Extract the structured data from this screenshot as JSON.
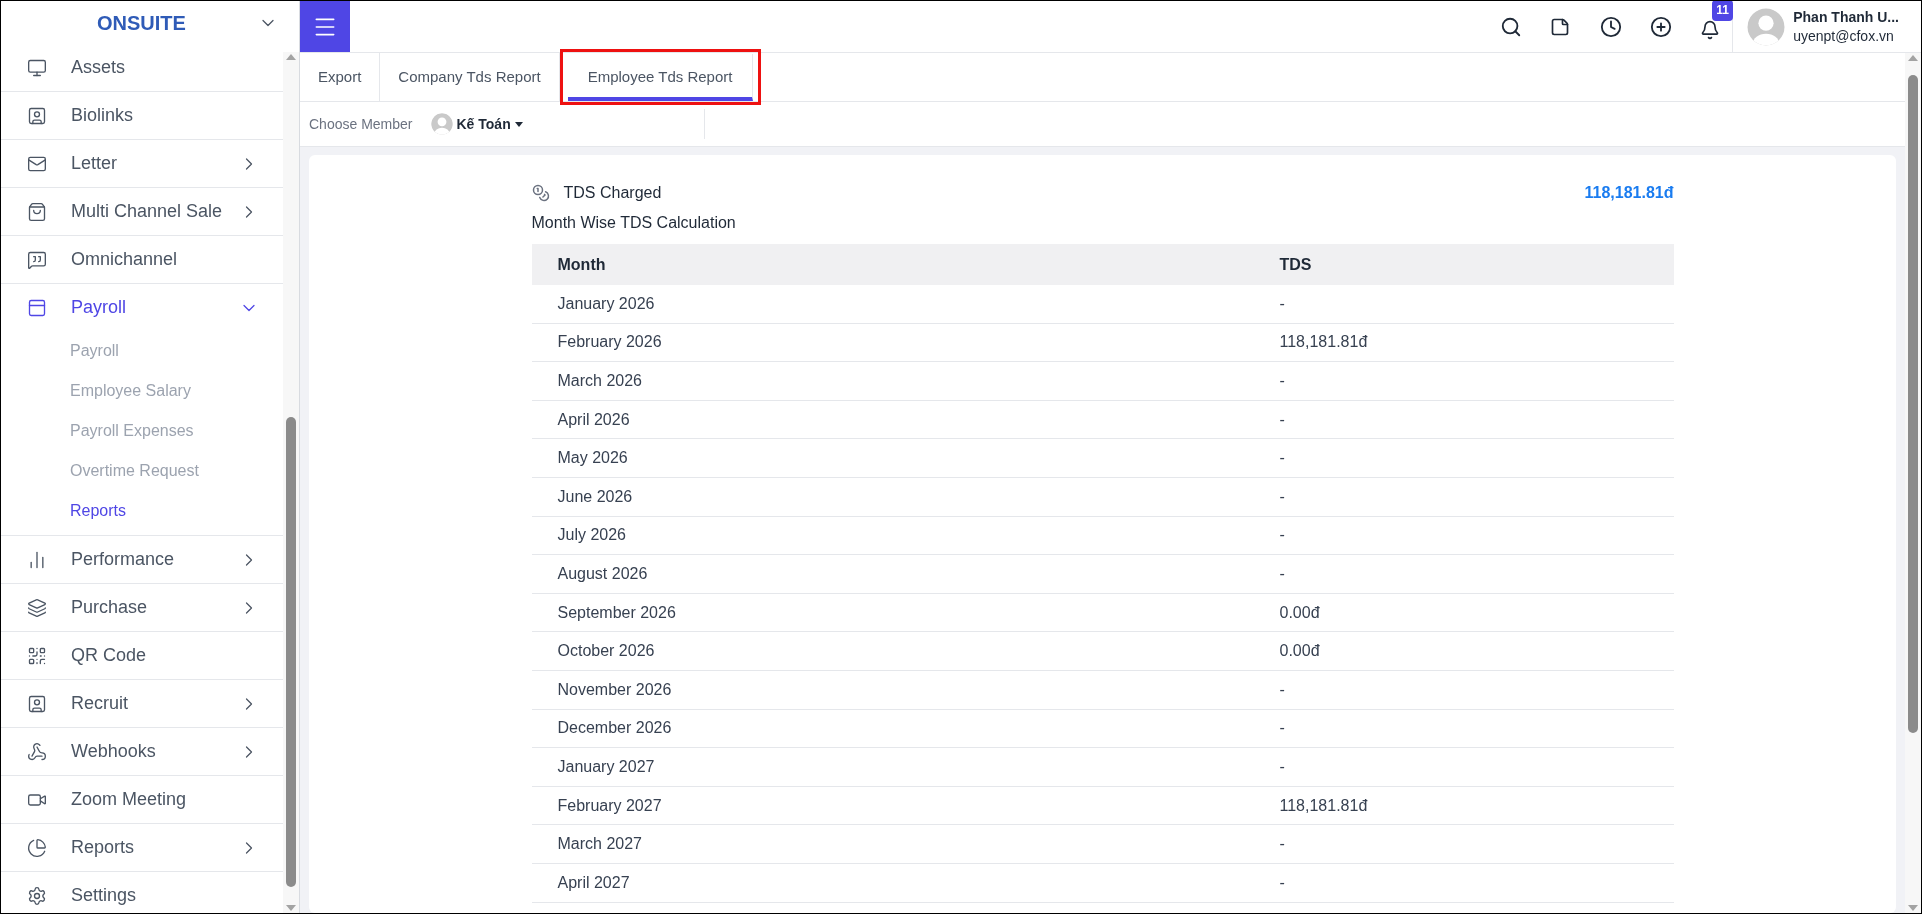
{
  "brand": {
    "title": "ONSUITE"
  },
  "sidebar": {
    "items": [
      {
        "label": "Assets",
        "kind": "link",
        "selected": false
      },
      {
        "label": "Biolinks",
        "kind": "link",
        "selected": false
      },
      {
        "label": "Letter",
        "kind": "group",
        "expanded": false,
        "selected": false
      },
      {
        "label": "Multi Channel Sale",
        "kind": "group",
        "expanded": false,
        "selected": false
      },
      {
        "label": "Omnichannel",
        "kind": "link",
        "selected": false
      },
      {
        "label": "Payroll",
        "kind": "group",
        "expanded": true,
        "selected": true,
        "children": [
          {
            "label": "Payroll",
            "selected": false
          },
          {
            "label": "Employee Salary",
            "selected": false
          },
          {
            "label": "Payroll Expenses",
            "selected": false
          },
          {
            "label": "Overtime Request",
            "selected": false
          },
          {
            "label": "Reports",
            "selected": true
          }
        ]
      },
      {
        "label": "Performance",
        "kind": "group",
        "expanded": false,
        "selected": false
      },
      {
        "label": "Purchase",
        "kind": "group",
        "expanded": false,
        "selected": false
      },
      {
        "label": "QR Code",
        "kind": "link",
        "selected": false
      },
      {
        "label": "Recruit",
        "kind": "group",
        "expanded": false,
        "selected": false
      },
      {
        "label": "Webhooks",
        "kind": "group",
        "expanded": false,
        "selected": false
      },
      {
        "label": "Zoom Meeting",
        "kind": "link",
        "selected": false
      },
      {
        "label": "Reports",
        "kind": "group",
        "expanded": false,
        "selected": false
      },
      {
        "label": "Settings",
        "kind": "link",
        "selected": false
      }
    ]
  },
  "header": {
    "notification_count": "11",
    "user": {
      "name": "Phan Thanh U...",
      "email": "uyenpt@cfox.vn"
    }
  },
  "tabs": [
    {
      "label": "Export",
      "selected": false,
      "highlighted": false
    },
    {
      "label": "Company Tds Report",
      "selected": false,
      "highlighted": false
    },
    {
      "label": "Employee Tds Report",
      "selected": true,
      "highlighted": true
    }
  ],
  "member": {
    "label": "Choose Member",
    "value": "Kế Toán"
  },
  "card": {
    "title": "TDS Charged",
    "total": "118,181.81đ",
    "subtitle": "Month Wise TDS Calculation",
    "table": {
      "columns": [
        "Month",
        "TDS"
      ],
      "rows": [
        [
          "January 2026",
          "-"
        ],
        [
          "February 2026",
          "118,181.81đ"
        ],
        [
          "March 2026",
          "-"
        ],
        [
          "April 2026",
          "-"
        ],
        [
          "May 2026",
          "-"
        ],
        [
          "June 2026",
          "-"
        ],
        [
          "July 2026",
          "-"
        ],
        [
          "August 2026",
          "-"
        ],
        [
          "September 2026",
          "0.00đ"
        ],
        [
          "October 2026",
          "0.00đ"
        ],
        [
          "November 2026",
          "-"
        ],
        [
          "December 2026",
          "-"
        ],
        [
          "January 2027",
          "-"
        ],
        [
          "February 2027",
          "118,181.81đ"
        ],
        [
          "March 2027",
          "-"
        ],
        [
          "April 2027",
          "-"
        ]
      ]
    }
  }
}
